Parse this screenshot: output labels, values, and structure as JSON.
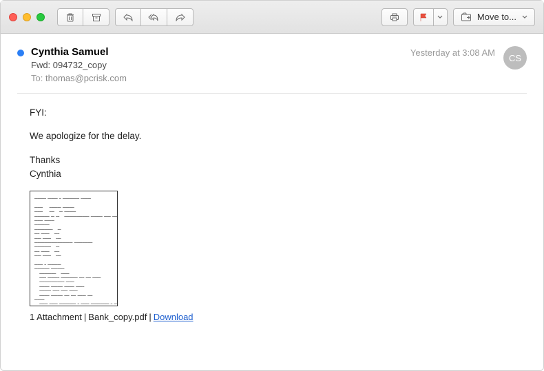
{
  "toolbar": {
    "moveto_label": "Move to..."
  },
  "sender": "Cynthia Samuel",
  "subject": "Fwd: 094732_copy",
  "to_label": "To:",
  "to_address": "thomas@pcrisk.com",
  "timestamp": "Yesterday at 3:08 AM",
  "avatar_initials": "CS",
  "body": {
    "line1": "FYI:",
    "line2": "We apologize for the delay.",
    "sig1": "Thanks",
    "sig2": "Cynthia"
  },
  "attachment": {
    "count_label": "1 Attachment",
    "filename": "Bank_copy.pdf",
    "download_label": "Download"
  }
}
